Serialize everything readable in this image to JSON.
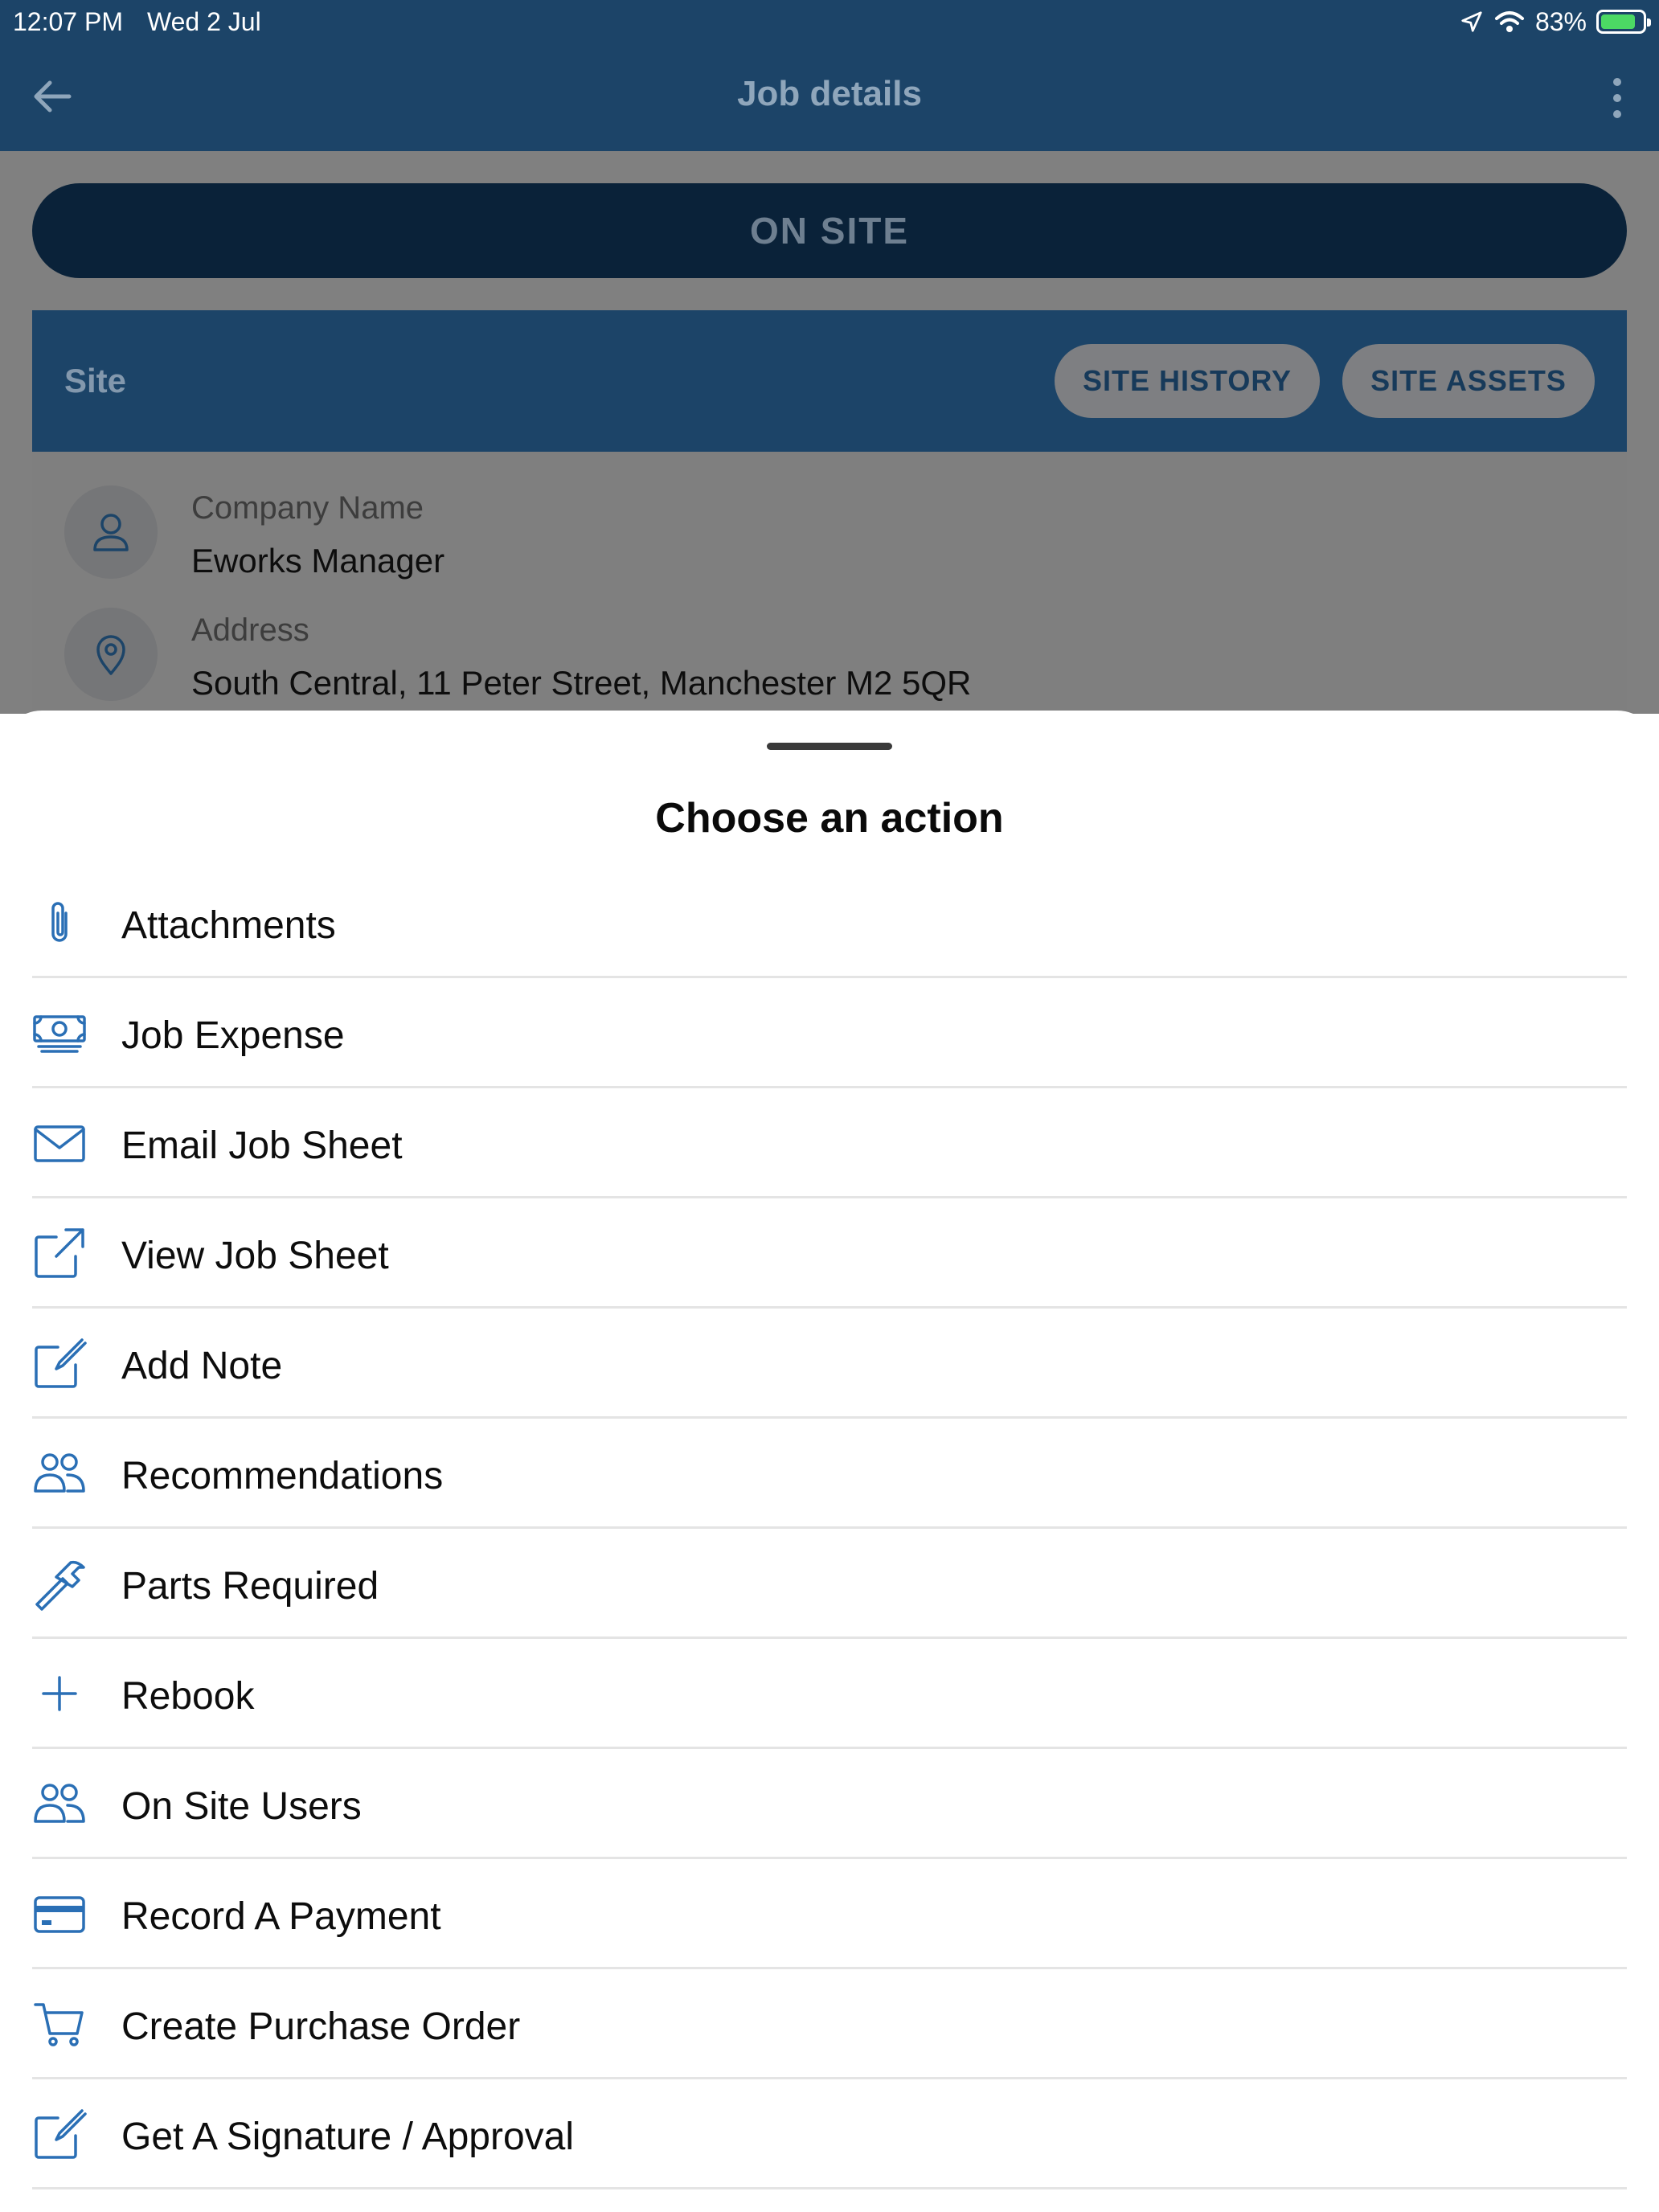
{
  "status_bar": {
    "time": "12:07 PM",
    "date": "Wed 2 Jul",
    "battery": "83%",
    "battery_level": 0.83
  },
  "app_bar": {
    "title": "Job details",
    "back_icon": "arrow-left-icon",
    "menu_icon": "more-vertical-icon"
  },
  "status_button": {
    "label": "ON SITE"
  },
  "site_card": {
    "header": "Site",
    "history_button": "SITE HISTORY",
    "assets_button": "SITE ASSETS",
    "company": {
      "label": "Company Name",
      "value": "Eworks Manager",
      "icon": "person-icon"
    },
    "address": {
      "label": "Address",
      "value": "South Central, 11 Peter Street, Manchester M2 5QR",
      "icon": "location-pin-icon"
    }
  },
  "sheet": {
    "title": "Choose an action",
    "actions": [
      {
        "label": "Attachments",
        "icon": "paperclip-icon"
      },
      {
        "label": "Job Expense",
        "icon": "cash-icon"
      },
      {
        "label": "Email Job Sheet",
        "icon": "envelope-icon"
      },
      {
        "label": "View Job Sheet",
        "icon": "external-link-icon"
      },
      {
        "label": "Add Note",
        "icon": "edit-note-icon"
      },
      {
        "label": "Recommendations",
        "icon": "users-icon"
      },
      {
        "label": "Parts Required",
        "icon": "hammer-icon"
      },
      {
        "label": "Rebook",
        "icon": "plus-icon"
      },
      {
        "label": "On Site Users",
        "icon": "users-icon"
      },
      {
        "label": "Record A Payment",
        "icon": "credit-card-icon"
      },
      {
        "label": "Create Purchase Order",
        "icon": "cart-icon"
      },
      {
        "label": "Get A Signature / Approval",
        "icon": "edit-note-icon"
      }
    ]
  },
  "colors": {
    "primary": "#1c4468",
    "accent_icon": "#2a6fb5",
    "on_site_button": "#0a2239"
  }
}
